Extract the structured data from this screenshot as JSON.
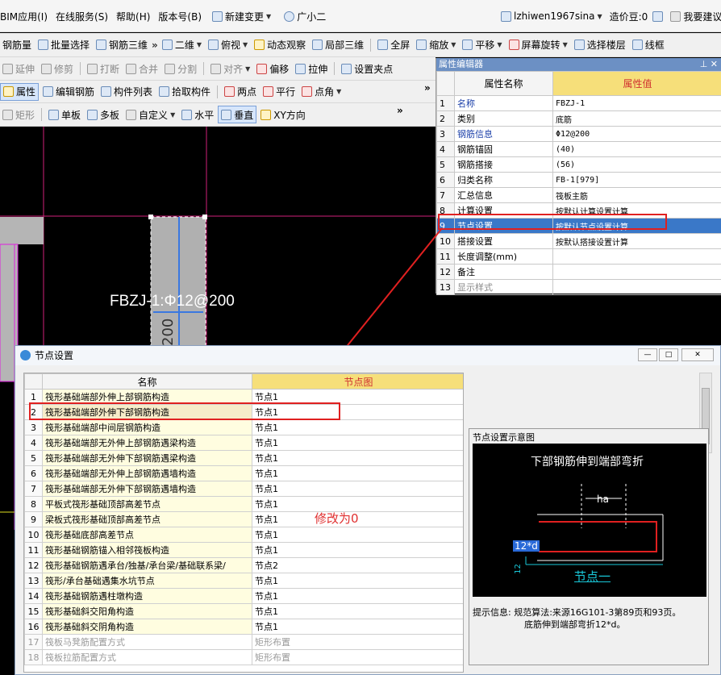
{
  "menubar": {
    "items": [
      "BIM应用(I)",
      "在线服务(S)",
      "帮助(H)",
      "版本号(B)"
    ],
    "new_change": "新建变更",
    "assistant": "广小二",
    "user": "lzhiwen1967sina",
    "bean": "造价豆:0",
    "suggest": "我要建议"
  },
  "toolbar1": [
    "钢筋量",
    "批量选择",
    "钢筋三维",
    "二维",
    "俯视",
    "动态观察",
    "局部三维",
    "全屏",
    "缩放",
    "平移",
    "屏幕旋转",
    "选择楼层",
    "线框"
  ],
  "toolbar2": [
    "延伸",
    "修剪",
    "打断",
    "合并",
    "分割",
    "对齐",
    "偏移",
    "拉伸",
    "设置夹点"
  ],
  "toolbar3": [
    "属性",
    "编辑钢筋",
    "构件列表",
    "拾取构件",
    "两点",
    "平行",
    "点角"
  ],
  "toolbar4": [
    "矩形",
    "单板",
    "多板",
    "自定义",
    "水平",
    "垂直",
    "XY方向"
  ],
  "canvas": {
    "label": "FBZJ-1:Φ12@200",
    "vertical_text": "@200"
  },
  "property_editor": {
    "title": "属性编辑器",
    "col_name": "属性名称",
    "col_value": "属性值",
    "rows": [
      {
        "n": "1",
        "name": "名称",
        "value": "FBZJ-1"
      },
      {
        "n": "2",
        "name": "类别",
        "value": "底筋"
      },
      {
        "n": "3",
        "name": "钢筋信息",
        "value": "Φ12@200"
      },
      {
        "n": "4",
        "name": "钢筋锚固",
        "value": "(40)"
      },
      {
        "n": "5",
        "name": "钢筋搭接",
        "value": "(56)"
      },
      {
        "n": "6",
        "name": "归类名称",
        "value": "FB-1[979]"
      },
      {
        "n": "7",
        "name": "汇总信息",
        "value": "筏板主筋"
      },
      {
        "n": "8",
        "name": "计算设置",
        "value": "按默认计算设置计算"
      },
      {
        "n": "9",
        "name": "节点设置",
        "value": "按默认节点设置计算"
      },
      {
        "n": "10",
        "name": "搭接设置",
        "value": "按默认搭接设置计算"
      },
      {
        "n": "11",
        "name": "长度调整(mm)",
        "value": ""
      },
      {
        "n": "12",
        "name": "备注",
        "value": ""
      },
      {
        "n": "13",
        "name": "显示样式",
        "value": ""
      }
    ]
  },
  "dialog": {
    "title": "节点设置",
    "col_name": "名称",
    "col_node": "节点图",
    "rows": [
      {
        "n": "1",
        "name": "筏形基础端部外伸上部钢筋构造",
        "node": "节点1"
      },
      {
        "n": "2",
        "name": "筏形基础端部外伸下部钢筋构造",
        "node": "节点1"
      },
      {
        "n": "3",
        "name": "筏形基础端部中间层钢筋构造",
        "node": "节点1"
      },
      {
        "n": "4",
        "name": "筏形基础端部无外伸上部钢筋遇梁构造",
        "node": "节点1"
      },
      {
        "n": "5",
        "name": "筏形基础端部无外伸下部钢筋遇梁构造",
        "node": "节点1"
      },
      {
        "n": "6",
        "name": "筏形基础端部无外伸上部钢筋遇墙构造",
        "node": "节点1"
      },
      {
        "n": "7",
        "name": "筏形基础端部无外伸下部钢筋遇墙构造",
        "node": "节点1"
      },
      {
        "n": "8",
        "name": "平板式筏形基础顶部高差节点",
        "node": "节点1"
      },
      {
        "n": "9",
        "name": "梁板式筏形基础顶部高差节点",
        "node": "节点1"
      },
      {
        "n": "10",
        "name": "筏形基础底部高差节点",
        "node": "节点1"
      },
      {
        "n": "11",
        "name": "筏形基础钢筋锚入相邻筏板构造",
        "node": "节点1"
      },
      {
        "n": "12",
        "name": "筏形基础钢筋遇承台/独基/承台梁/基础联系梁/",
        "node": "节点2"
      },
      {
        "n": "13",
        "name": "筏形/承台基础遇集水坑节点",
        "node": "节点1"
      },
      {
        "n": "14",
        "name": "筏形基础钢筋遇柱墩构造",
        "node": "节点1"
      },
      {
        "n": "15",
        "name": "筏形基础斜交阳角构造",
        "node": "节点1"
      },
      {
        "n": "16",
        "name": "筏形基础斜交阴角构造",
        "node": "节点1"
      },
      {
        "n": "17",
        "name": "筏板马凳筋配置方式",
        "node": "矩形布置"
      },
      {
        "n": "18",
        "name": "筏板拉筋配置方式",
        "node": "矩形布置"
      }
    ],
    "preview_label": "节点设置示意图",
    "preview_title": "下部钢筋伸到端部弯折",
    "preview_ha": "ha",
    "preview_dim": "12*d",
    "preview_dim_v": "12",
    "preview_node": "节点一",
    "tip_label": "提示信息:",
    "tip_line1": "规范算法:来源16G101-3第89页和93页。",
    "tip_line2": "底筋伸到端部弯折12*d。"
  },
  "annotation": "修改为0",
  "colors": {
    "accent_red": "#e02020",
    "canvas_bg": "#000000",
    "cyan": "#19c7d8",
    "selection": "#3a78c8"
  }
}
